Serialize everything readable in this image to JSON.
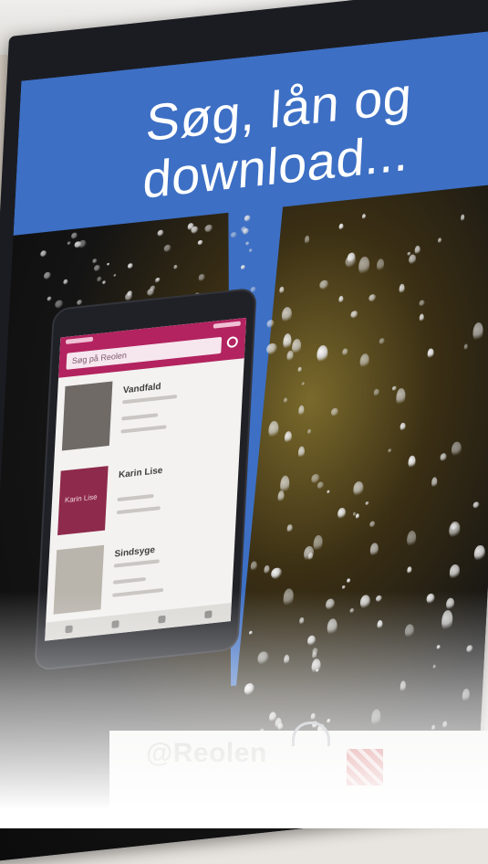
{
  "headline": "Søg, lån og\ndownload...",
  "brand": "@Reolen",
  "phone_app": {
    "search_placeholder": "Søg på Reolen",
    "books": [
      {
        "title": "Vandfald",
        "cover_color": "#6f6a66"
      },
      {
        "title": "Karin Lise",
        "cover_color": "#8e2a4c"
      },
      {
        "title": "Sindsyge",
        "cover_color": "#b9b4ac"
      }
    ]
  },
  "colors": {
    "banner": "#3d6fc4",
    "app_header": "#b2235f",
    "screen_background": "#141414"
  }
}
